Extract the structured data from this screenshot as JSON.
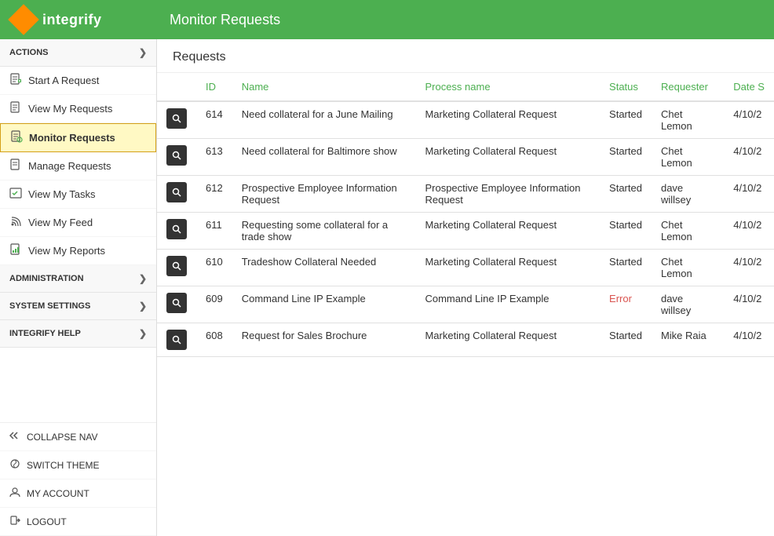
{
  "header": {
    "logo_text": "integrify",
    "page_title": "Monitor Requests"
  },
  "sidebar": {
    "actions_label": "ACTIONS",
    "items": [
      {
        "id": "start-request",
        "label": "Start A Request",
        "icon": "📋",
        "active": false
      },
      {
        "id": "view-my-requests",
        "label": "View My Requests",
        "icon": "📋",
        "active": false
      },
      {
        "id": "monitor-requests",
        "label": "Monitor Requests",
        "icon": "📋",
        "active": true
      },
      {
        "id": "manage-requests",
        "label": "Manage Requests",
        "icon": "📋",
        "active": false
      },
      {
        "id": "view-my-tasks",
        "label": "View My Tasks",
        "icon": "📋",
        "active": false
      },
      {
        "id": "view-my-feed",
        "label": "View My Feed",
        "icon": "📋",
        "active": false
      },
      {
        "id": "view-my-reports",
        "label": "View My Reports",
        "icon": "📋",
        "active": false
      }
    ],
    "administration_label": "ADMINISTRATION",
    "system_settings_label": "SYSTEM SETTINGS",
    "integrify_help_label": "INTEGRIFY HELP",
    "bottom_items": [
      {
        "id": "collapse-nav",
        "label": "COLLAPSE NAV",
        "icon": "↔"
      },
      {
        "id": "switch-theme",
        "label": "SWITCH THEME",
        "icon": "🎨"
      },
      {
        "id": "my-account",
        "label": "MY ACCOUNT",
        "icon": "👤"
      },
      {
        "id": "logout",
        "label": "LOGOUT",
        "icon": "🚪"
      }
    ]
  },
  "content": {
    "title": "Requests",
    "table": {
      "columns": [
        "",
        "ID",
        "Name",
        "Process name",
        "Status",
        "Requester",
        "Date S"
      ],
      "rows": [
        {
          "id": "614",
          "name": "Need collateral for a June Mailing",
          "process_name": "Marketing Collateral Request",
          "status": "Started",
          "requester": "Chet Lemon",
          "date": "4/10/2"
        },
        {
          "id": "613",
          "name": "Need collateral for Baltimore show",
          "process_name": "Marketing Collateral Request",
          "status": "Started",
          "requester": "Chet Lemon",
          "date": "4/10/2"
        },
        {
          "id": "612",
          "name": "Prospective Employee Information Request",
          "process_name": "Prospective Employee Information Request",
          "status": "Started",
          "requester": "dave willsey",
          "date": "4/10/2"
        },
        {
          "id": "611",
          "name": "Requesting some collateral for a trade show",
          "process_name": "Marketing Collateral Request",
          "status": "Started",
          "requester": "Chet Lemon",
          "date": "4/10/2"
        },
        {
          "id": "610",
          "name": "Tradeshow Collateral Needed",
          "process_name": "Marketing Collateral Request",
          "status": "Started",
          "requester": "Chet Lemon",
          "date": "4/10/2"
        },
        {
          "id": "609",
          "name": "Command Line IP Example",
          "process_name": "Command Line IP Example",
          "status": "Error",
          "requester": "dave willsey",
          "date": "4/10/2"
        },
        {
          "id": "608",
          "name": "Request for Sales Brochure",
          "process_name": "Marketing Collateral Request",
          "status": "Started",
          "requester": "Mike Raia",
          "date": "4/10/2"
        }
      ]
    }
  }
}
